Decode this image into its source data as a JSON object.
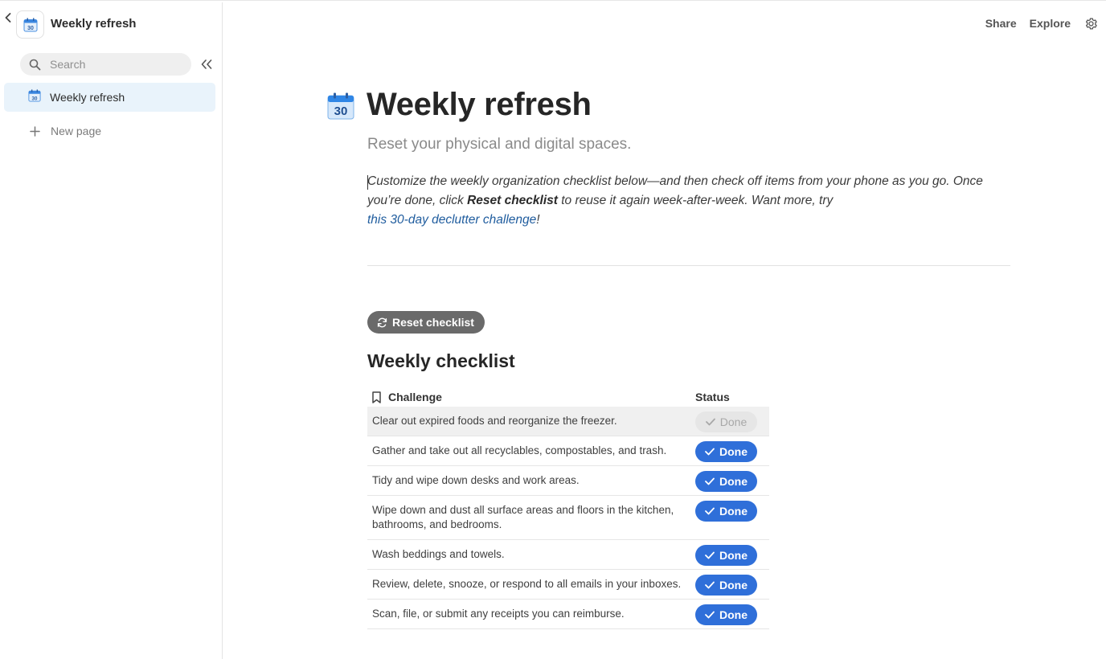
{
  "app": {
    "title": "Weekly refresh",
    "search_placeholder": "Search",
    "nav_items": [
      {
        "label": "Weekly refresh"
      }
    ],
    "new_page_label": "New page",
    "calendar_number": "30"
  },
  "topnav": {
    "share": "Share",
    "explore": "Explore"
  },
  "page": {
    "title": "Weekly refresh",
    "subtitle": "Reset your physical and digital spaces.",
    "intro_part1": "Customize the weekly organization checklist below—and then check off items from your phone as you go. Once you’re done, click ",
    "intro_bold": "Reset checklist",
    "intro_part2": " to reuse it again week-after-week. Want more, try ",
    "intro_link": "this 30-day declutter challenge",
    "intro_end": "!",
    "reset_label": "Reset checklist",
    "section_title": "Weekly checklist"
  },
  "table": {
    "headers": {
      "challenge": "Challenge",
      "status": "Status"
    },
    "rows": [
      {
        "challenge": "Clear out expired foods and reorganize the freezer.",
        "status": "Done"
      },
      {
        "challenge": "Gather and take out all recyclables, compostables, and trash.",
        "status": "Done"
      },
      {
        "challenge": "Tidy and wipe down desks and work areas.",
        "status": "Done"
      },
      {
        "challenge": "Wipe down and dust all surface areas and floors in the kitchen, bathrooms, and bedrooms.",
        "status": "Done"
      },
      {
        "challenge": "Wash beddings and towels.",
        "status": "Done"
      },
      {
        "challenge": "Review, delete, snooze, or respond to all emails in your inboxes.",
        "status": "Done"
      },
      {
        "challenge": "Scan, file, or submit any receipts you can reimburse.",
        "status": "Done"
      }
    ]
  },
  "colors": {
    "accent": "#2f6fd9",
    "nav_selected": "#e9f3fb",
    "reset_button": "#6a6a6a",
    "link": "#1f5c9e"
  },
  "icons": [
    "back-chevron-icon",
    "calendar-icon",
    "search-icon",
    "collapse-sidebar-icon",
    "plus-icon",
    "gear-icon",
    "refresh-icon",
    "bookmark-icon",
    "check-icon"
  ]
}
